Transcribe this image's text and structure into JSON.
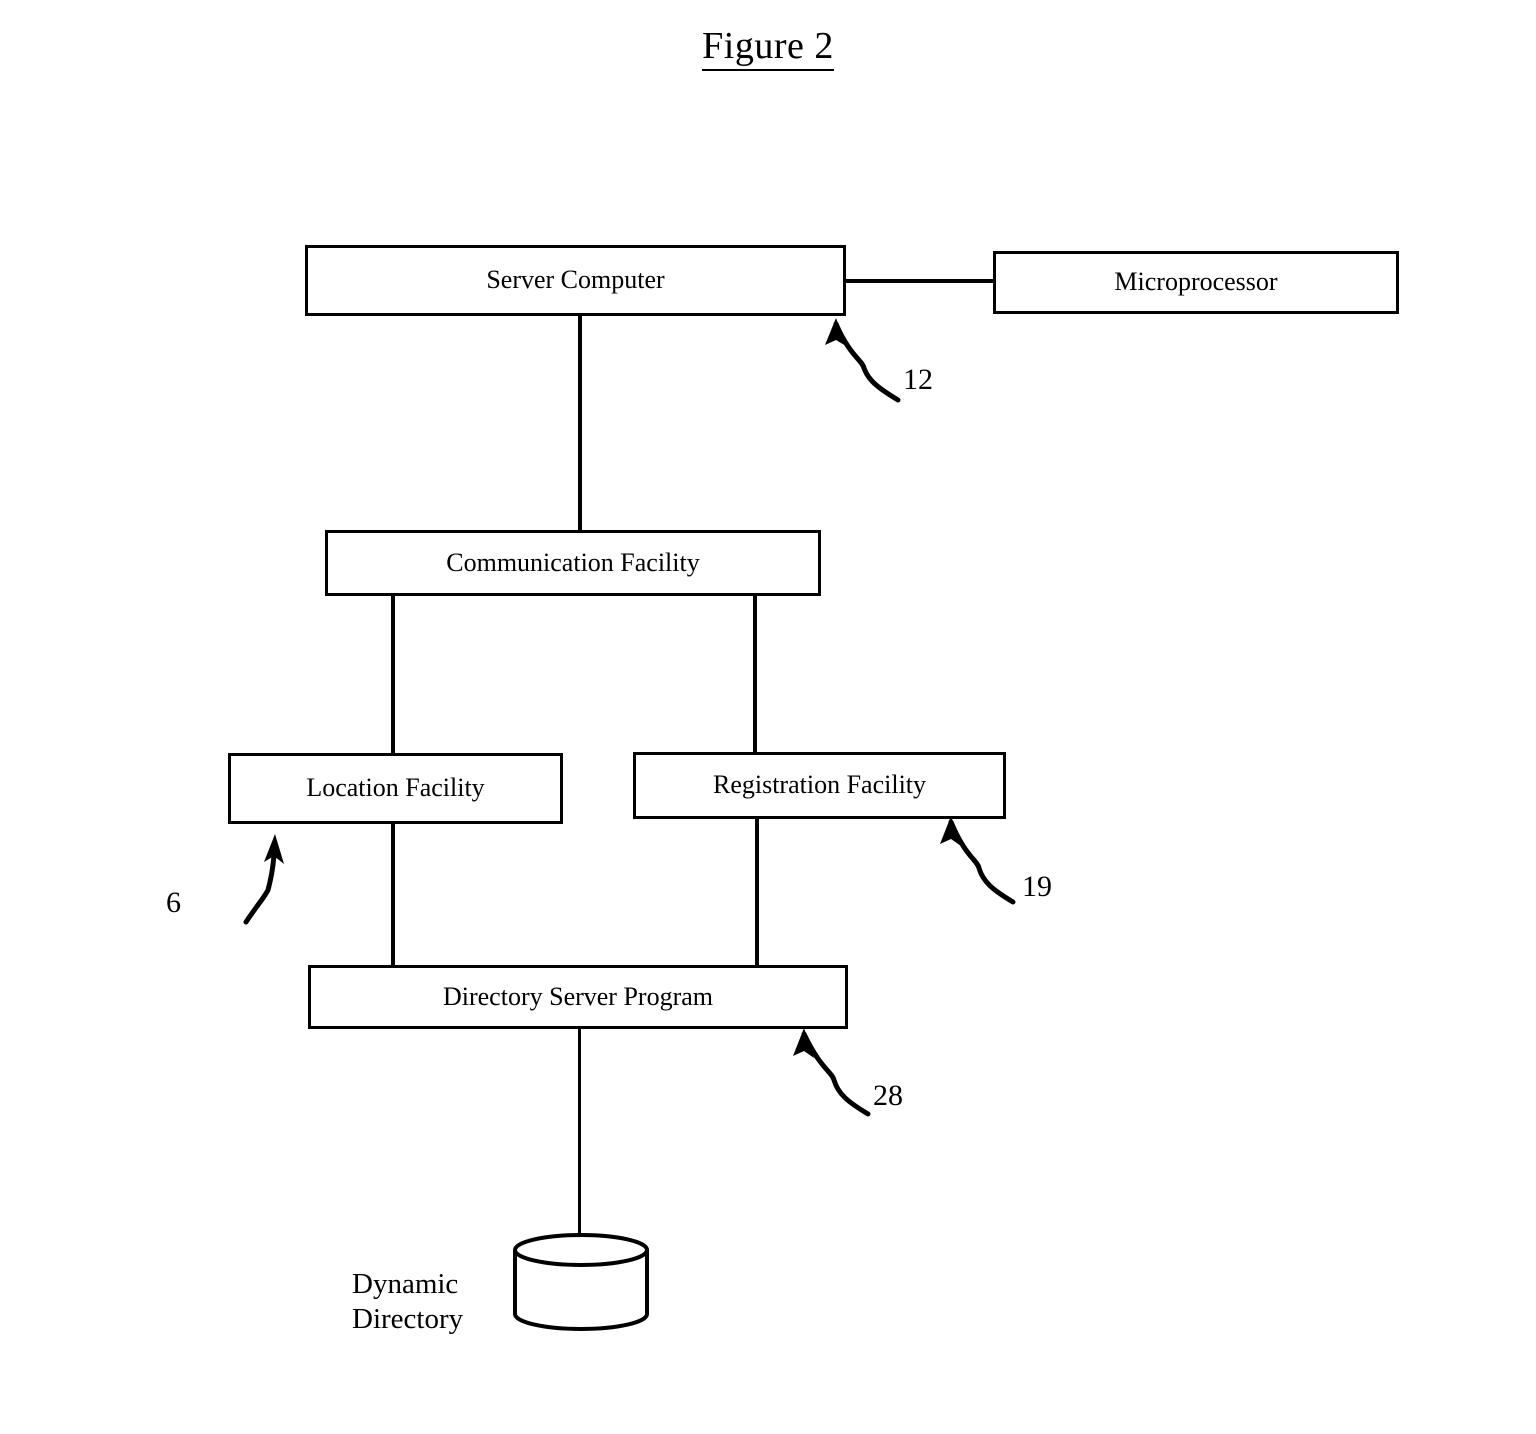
{
  "figure": {
    "title": "Figure 2"
  },
  "nodes": {
    "server_computer": "Server Computer",
    "microprocessor": "Microprocessor",
    "communication_facility": "Communication Facility",
    "location_facility": "Location Facility",
    "registration_facility": "Registration Facility",
    "directory_server_program": "Directory Server Program"
  },
  "labels": {
    "dynamic_directory": "Dynamic\nDirectory"
  },
  "reference_numerals": {
    "server_computer": "12",
    "location_facility": "6",
    "registration_facility": "19",
    "directory_server_program": "28"
  },
  "colors": {
    "stroke": "#000000",
    "background": "#ffffff"
  }
}
